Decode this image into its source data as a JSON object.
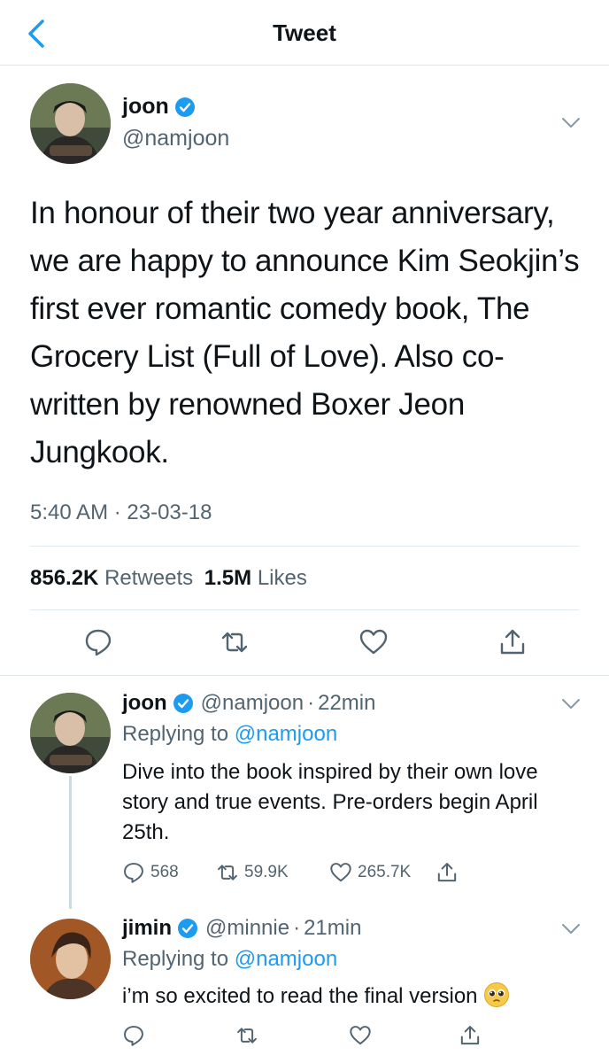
{
  "header": {
    "title": "Tweet",
    "back_icon": "chevron-left-icon"
  },
  "main_tweet": {
    "name": "joon",
    "handle": "@namjoon",
    "text": "In honour of their two year anniversary, we are happy to announce Kim Seokjin’s first ever romantic comedy book, The Grocery List (Full of Love). Also co-written by renowned Boxer Jeon Jungkook.",
    "time": "5:40 AM · 23-03-18",
    "retweets_count": "856.2K",
    "retweets_label": "Retweets",
    "likes_count": "1.5M",
    "likes_label": "Likes",
    "actions": [
      "reply-icon",
      "retweet-icon",
      "like-icon",
      "share-icon"
    ]
  },
  "replies": [
    {
      "name": "joon",
      "handle": "@namjoon",
      "dot": "·",
      "time": "22min",
      "replying_prefix": "Replying to ",
      "replying_to": "@namjoon",
      "text": "Dive into the book inspired by their own love story and true events. Pre-orders begin April 25th.",
      "reply_count": "568",
      "retweet_count": "59.9K",
      "like_count": "265.7K"
    },
    {
      "name": "jimin",
      "handle": "@minnie",
      "dot": "·",
      "time": "21min",
      "replying_prefix": "Replying to ",
      "replying_to": "@namjoon",
      "text": "i’m so excited to read the final version",
      "emoji": "pleading-face-emoji"
    }
  ],
  "colors": {
    "accent": "#1d9bf0",
    "text": "#0f1419",
    "muted": "#536471",
    "divider": "#e1e8ed"
  }
}
